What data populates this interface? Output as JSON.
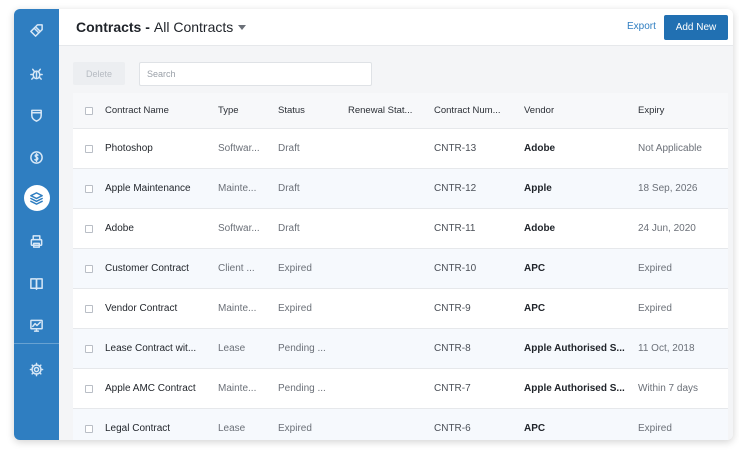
{
  "sidebar": {
    "items": [
      {
        "icon": "tag-icon",
        "active": false
      },
      {
        "icon": "bug-icon",
        "active": false
      },
      {
        "icon": "shield-icon",
        "active": false
      },
      {
        "icon": "dollar-icon",
        "active": false
      },
      {
        "icon": "layers-icon",
        "active": true
      },
      {
        "icon": "printer-icon",
        "active": false
      },
      {
        "icon": "book-icon",
        "active": false
      },
      {
        "icon": "chart-icon",
        "active": false
      },
      {
        "icon": "gear-icon",
        "active": false
      }
    ],
    "color": "#2f7ec1"
  },
  "header": {
    "title_bold": "Contracts -",
    "title_view": "All Contracts",
    "export_label": "Export",
    "add_new_label": "Add New",
    "accent": "#2170b2"
  },
  "toolbar": {
    "delete_label": "Delete",
    "search_placeholder": "Search"
  },
  "table": {
    "columns": [
      "Contract Name",
      "Type",
      "Status",
      "Renewal Stat...",
      "Contract Num...",
      "Vendor",
      "Expiry"
    ],
    "rows": [
      {
        "name": "Photoshop",
        "type": "Softwar...",
        "status": "Draft",
        "renewal": "",
        "number": "CNTR-13",
        "vendor": "Adobe",
        "expiry": "Not Applicable"
      },
      {
        "name": "Apple Maintenance",
        "type": "Mainte...",
        "status": "Draft",
        "renewal": "",
        "number": "CNTR-12",
        "vendor": "Apple",
        "expiry": "18 Sep, 2026"
      },
      {
        "name": "Adobe",
        "type": "Softwar...",
        "status": "Draft",
        "renewal": "",
        "number": "CNTR-11",
        "vendor": "Adobe",
        "expiry": "24 Jun, 2020"
      },
      {
        "name": "Customer Contract",
        "type": "Client ...",
        "status": "Expired",
        "renewal": "",
        "number": "CNTR-10",
        "vendor": "APC",
        "expiry": "Expired"
      },
      {
        "name": "Vendor Contract",
        "type": "Mainte...",
        "status": "Expired",
        "renewal": "",
        "number": "CNTR-9",
        "vendor": "APC",
        "expiry": "Expired"
      },
      {
        "name": "Lease Contract wit...",
        "type": "Lease",
        "status": "Pending ...",
        "renewal": "",
        "number": "CNTR-8",
        "vendor": "Apple Authorised S...",
        "expiry": "11 Oct, 2018"
      },
      {
        "name": "Apple AMC Contract",
        "type": "Mainte...",
        "status": "Pending ...",
        "renewal": "",
        "number": "CNTR-7",
        "vendor": "Apple Authorised S...",
        "expiry": "Within 7 days"
      },
      {
        "name": "Legal Contract",
        "type": "Lease",
        "status": "Expired",
        "renewal": "",
        "number": "CNTR-6",
        "vendor": "APC",
        "expiry": "Expired"
      }
    ]
  }
}
